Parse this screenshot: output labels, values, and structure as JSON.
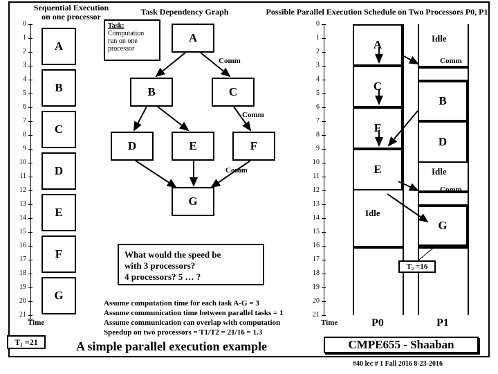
{
  "hdr": {
    "seq": "Sequential Execution\non one processor",
    "dep": "Task Dependency Graph",
    "par": "Possible Parallel Execution Schedule on Two Processors P0, P1"
  },
  "legend": {
    "title": "Task:",
    "body": "Computation\nrun on one\nprocessor"
  },
  "tasks": [
    "A",
    "B",
    "C",
    "D",
    "E",
    "F",
    "G"
  ],
  "axis": {
    "time": "Time",
    "t1": "T₁ =21",
    "t2": "T₂ =16"
  },
  "p": {
    "p0": "P0",
    "p1": "P1",
    "idle": "Idle",
    "comm": "Comm"
  },
  "q": {
    "line1": "What would the speed be",
    "line2": "with 3 processors?",
    "line3": "4 processors?  5 … ?"
  },
  "assume": {
    "a1": "Assume computation time for each task A-G = 3",
    "a2": "Assume communication time between parallel tasks = 1",
    "a3": "Assume communication can overlap with computation",
    "a4": "Speedup on two processors =  T1/T2  = 21/16 = 1.3"
  },
  "title": "A simple parallel execution example",
  "course": "CMPE655 - Shaaban",
  "pg": "#40  lec # 1    Fall 2016   8-23-2016",
  "chart_data": {
    "type": "table",
    "sequential": {
      "processor": "single",
      "tasks": [
        {
          "name": "A",
          "start": 0,
          "end": 3
        },
        {
          "name": "B",
          "start": 3,
          "end": 6
        },
        {
          "name": "C",
          "start": 6,
          "end": 9
        },
        {
          "name": "D",
          "start": 9,
          "end": 12
        },
        {
          "name": "E",
          "start": 12,
          "end": 15
        },
        {
          "name": "F",
          "start": 15,
          "end": 18
        },
        {
          "name": "G",
          "start": 18,
          "end": 21
        }
      ],
      "T1": 21
    },
    "dependency_edges": [
      [
        "A",
        "B"
      ],
      [
        "A",
        "C"
      ],
      [
        "B",
        "D"
      ],
      [
        "B",
        "E"
      ],
      [
        "C",
        "F"
      ],
      [
        "D",
        "G"
      ],
      [
        "E",
        "G"
      ],
      [
        "F",
        "G"
      ]
    ],
    "parallel": {
      "P0": [
        {
          "name": "A",
          "start": 0,
          "end": 3
        },
        {
          "name": "C",
          "start": 3,
          "end": 6
        },
        {
          "name": "F",
          "start": 6,
          "end": 9
        },
        {
          "name": "E",
          "start": 9,
          "end": 12
        },
        {
          "name": "Idle",
          "start": 12,
          "end": 16
        }
      ],
      "P1": [
        {
          "name": "Idle",
          "start": 0,
          "end": 3
        },
        {
          "name": "B",
          "start": 4,
          "end": 7
        },
        {
          "name": "D",
          "start": 7,
          "end": 10
        },
        {
          "name": "Idle",
          "start": 10,
          "end": 12
        },
        {
          "name": "G",
          "start": 13,
          "end": 16
        }
      ],
      "comm_events": [
        {
          "from": "A",
          "to": "B",
          "time": 3
        },
        {
          "from": "B",
          "to": "E",
          "time": 7
        },
        {
          "from": "E",
          "to": "G",
          "time": 12
        }
      ],
      "T2": 16
    }
  }
}
